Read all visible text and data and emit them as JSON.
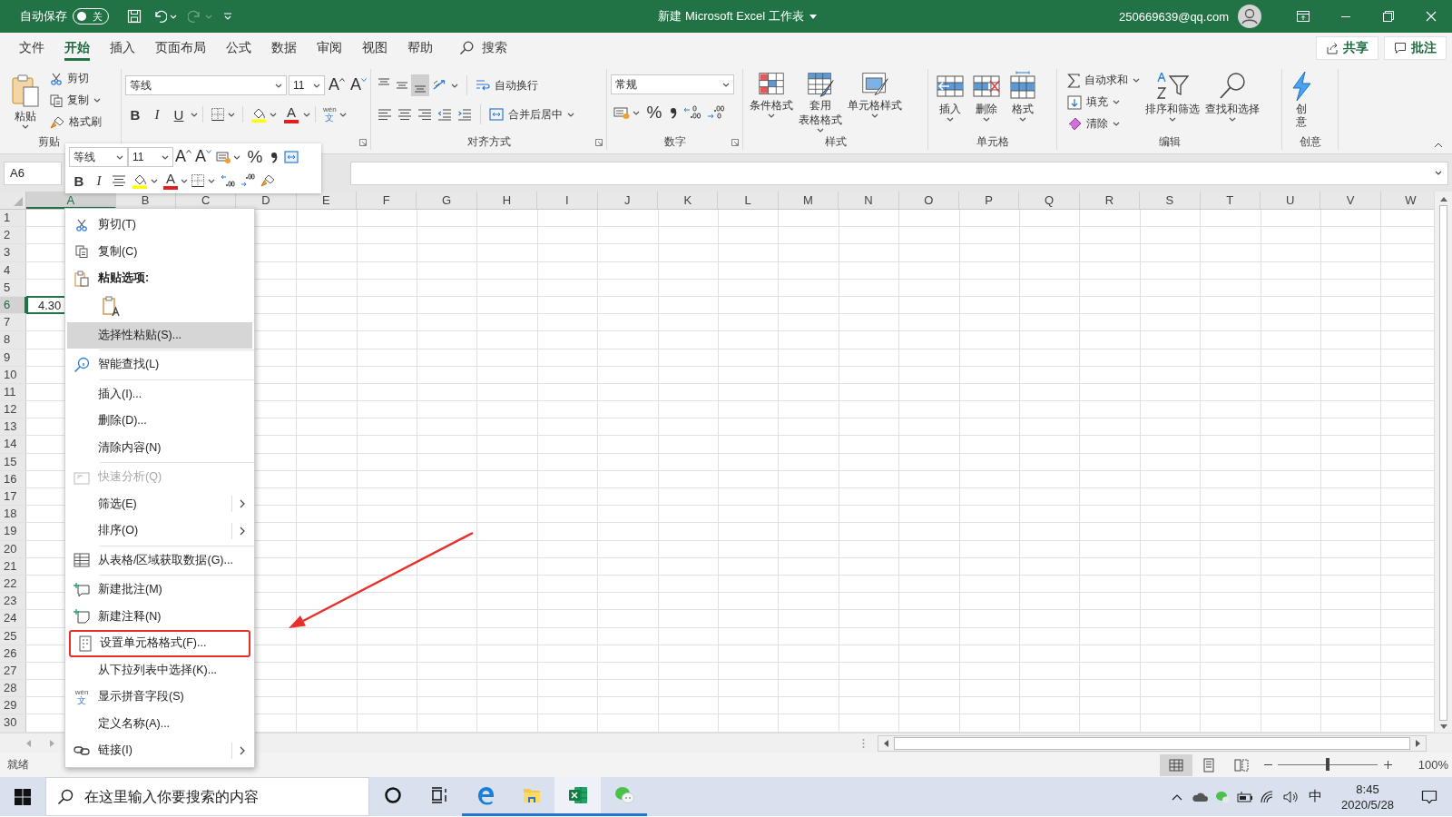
{
  "title_bar": {
    "autosave_label": "自动保存",
    "autosave_on": false,
    "autosave_state": "关",
    "redo_disabled": true,
    "title": "新建 Microsoft Excel 工作表",
    "account": "250669639@qq.com"
  },
  "menu_tabs": [
    {
      "label": "文件",
      "selected": false
    },
    {
      "label": "开始",
      "selected": true
    },
    {
      "label": "插入",
      "selected": false
    },
    {
      "label": "页面布局",
      "selected": false
    },
    {
      "label": "公式",
      "selected": false
    },
    {
      "label": "数据",
      "selected": false
    },
    {
      "label": "审阅",
      "selected": false
    },
    {
      "label": "视图",
      "selected": false
    },
    {
      "label": "帮助",
      "selected": false
    }
  ],
  "search_label": "搜索",
  "share_button": "共享",
  "comments_button": "批注",
  "ribbon": {
    "clipboard": {
      "paste": "粘贴",
      "cut": "剪切",
      "copy": "复制",
      "format_painter": "格式刷",
      "label": "剪贴"
    },
    "font": {
      "font_name": "等线",
      "font_size": "11",
      "grow": "A",
      "shrink": "A",
      "bold": "B",
      "italic": "I",
      "underline": "U",
      "font_color": "A",
      "phonetic_top": "wén",
      "phonetic_bottom": "文"
    },
    "alignment": {
      "vertical_align": [
        {
          "selected": false
        },
        {
          "selected": false
        },
        {
          "selected": true
        }
      ],
      "wrap_text": "自动换行",
      "merge_center": "合并后居中",
      "label": "对齐方式"
    },
    "number": {
      "format": "常规",
      "percent": "%",
      "label": "数字"
    },
    "styles": {
      "buttons": [
        {
          "lines": [
            "条件格式"
          ]
        },
        {
          "lines": [
            "套用",
            "表格格式"
          ]
        },
        {
          "lines": [
            "单元格样式"
          ]
        }
      ],
      "label": "样式"
    },
    "cells": {
      "buttons": [
        "插入",
        "删除",
        "格式"
      ],
      "label": "单元格"
    },
    "editing": {
      "autosum": "自动求和",
      "fill": "填充",
      "clear": "清除",
      "sort_filter": "排序和筛选",
      "find_select": "查找和选择",
      "label": "编辑"
    },
    "ideas": {
      "button": "创意",
      "label": "创意"
    }
  },
  "mini_toolbar": {
    "font_name": "等线",
    "font_size": "11",
    "grow": "A",
    "shrink": "A",
    "percent": "%",
    "bold": "B",
    "italic": "I",
    "font_color": "A"
  },
  "name_box": "A6",
  "columns": [
    {
      "label": "A",
      "selected": true
    },
    {
      "label": "B",
      "selected": false
    },
    {
      "label": "C",
      "selected": false
    },
    {
      "label": "D",
      "selected": false
    },
    {
      "label": "E",
      "selected": false
    },
    {
      "label": "F",
      "selected": false
    },
    {
      "label": "G",
      "selected": false
    },
    {
      "label": "H",
      "selected": false
    },
    {
      "label": "I",
      "selected": false
    },
    {
      "label": "J",
      "selected": false
    },
    {
      "label": "K",
      "selected": false
    },
    {
      "label": "L",
      "selected": false
    },
    {
      "label": "M",
      "selected": false
    },
    {
      "label": "N",
      "selected": false
    },
    {
      "label": "O",
      "selected": false
    },
    {
      "label": "P",
      "selected": false
    },
    {
      "label": "Q",
      "selected": false
    },
    {
      "label": "R",
      "selected": false
    },
    {
      "label": "S",
      "selected": false
    },
    {
      "label": "T",
      "selected": false
    },
    {
      "label": "U",
      "selected": false
    },
    {
      "label": "V",
      "selected": false
    },
    {
      "label": "W",
      "selected": false
    }
  ],
  "rows": [
    {
      "label": "1",
      "selected": false
    },
    {
      "label": "2",
      "selected": false
    },
    {
      "label": "3",
      "selected": false
    },
    {
      "label": "4",
      "selected": false
    },
    {
      "label": "5",
      "selected": false
    },
    {
      "label": "6",
      "selected": true,
      "cells": [
        "4.30"
      ]
    },
    {
      "label": "7",
      "selected": false
    },
    {
      "label": "8",
      "selected": false
    },
    {
      "label": "9",
      "selected": false
    },
    {
      "label": "10",
      "selected": false
    },
    {
      "label": "11",
      "selected": false
    },
    {
      "label": "12",
      "selected": false
    },
    {
      "label": "13",
      "selected": false
    },
    {
      "label": "14",
      "selected": false
    },
    {
      "label": "15",
      "selected": false
    },
    {
      "label": "16",
      "selected": false
    },
    {
      "label": "17",
      "selected": false
    },
    {
      "label": "18",
      "selected": false
    },
    {
      "label": "19",
      "selected": false
    },
    {
      "label": "20",
      "selected": false
    },
    {
      "label": "21",
      "selected": false
    },
    {
      "label": "22",
      "selected": false
    },
    {
      "label": "23",
      "selected": false
    },
    {
      "label": "24",
      "selected": false
    },
    {
      "label": "25",
      "selected": false
    },
    {
      "label": "26",
      "selected": false
    },
    {
      "label": "27",
      "selected": false
    },
    {
      "label": "28",
      "selected": false
    },
    {
      "label": "29",
      "selected": false
    },
    {
      "label": "30",
      "selected": false
    }
  ],
  "context_menu": {
    "callout_arrow": true,
    "items": [
      {
        "kind": "item",
        "label": "剪切(T)",
        "selected": false,
        "disabled": false,
        "submenu": false,
        "outlined": false
      },
      {
        "kind": "item",
        "label": "复制(C)",
        "selected": false,
        "disabled": false,
        "submenu": false,
        "outlined": false
      },
      {
        "kind": "header",
        "label": "粘贴选项:"
      },
      {
        "kind": "paste_options"
      },
      {
        "kind": "item",
        "label": "选择性粘贴(S)...",
        "selected": true,
        "disabled": false,
        "submenu": false,
        "outlined": false
      },
      {
        "kind": "separator"
      },
      {
        "kind": "item",
        "label": "智能查找(L)",
        "selected": false,
        "disabled": false,
        "submenu": false,
        "outlined": false
      },
      {
        "kind": "separator"
      },
      {
        "kind": "item",
        "label": "插入(I)...",
        "selected": false,
        "disabled": false,
        "submenu": false,
        "outlined": false
      },
      {
        "kind": "item",
        "label": "删除(D)...",
        "selected": false,
        "disabled": false,
        "submenu": false,
        "outlined": false
      },
      {
        "kind": "item",
        "label": "清除内容(N)",
        "selected": false,
        "disabled": false,
        "submenu": false,
        "outlined": false
      },
      {
        "kind": "separator"
      },
      {
        "kind": "item",
        "label": "快速分析(Q)",
        "selected": false,
        "disabled": true,
        "submenu": false,
        "outlined": false
      },
      {
        "kind": "item",
        "label": "筛选(E)",
        "selected": false,
        "disabled": false,
        "submenu": true,
        "outlined": false
      },
      {
        "kind": "item",
        "label": "排序(O)",
        "selected": false,
        "disabled": false,
        "submenu": true,
        "outlined": false
      },
      {
        "kind": "separator"
      },
      {
        "kind": "item",
        "label": "从表格/区域获取数据(G)...",
        "selected": false,
        "disabled": false,
        "submenu": false,
        "outlined": false
      },
      {
        "kind": "separator"
      },
      {
        "kind": "item",
        "label": "新建批注(M)",
        "selected": false,
        "disabled": false,
        "submenu": false,
        "outlined": false
      },
      {
        "kind": "item",
        "label": "新建注释(N)",
        "selected": false,
        "disabled": false,
        "submenu": false,
        "outlined": false
      },
      {
        "kind": "item",
        "label": "设置单元格格式(F)...",
        "selected": false,
        "disabled": false,
        "submenu": false,
        "outlined": true
      },
      {
        "kind": "item",
        "label": "从下拉列表中选择(K)...",
        "selected": false,
        "disabled": false,
        "submenu": false,
        "outlined": false
      },
      {
        "kind": "item",
        "label": "显示拼音字段(S)",
        "icon_top": "wén",
        "icon_bottom": "文",
        "selected": false,
        "disabled": false,
        "submenu": false,
        "outlined": false
      },
      {
        "kind": "item",
        "label": "定义名称(A)...",
        "selected": false,
        "disabled": false,
        "submenu": false,
        "outlined": false
      },
      {
        "kind": "item",
        "label": "链接(I)",
        "selected": false,
        "disabled": false,
        "submenu": true,
        "outlined": false
      }
    ]
  },
  "status_bar": {
    "text": "就绪",
    "views": [
      {
        "kind": "normal",
        "selected": true
      },
      {
        "kind": "page_layout",
        "selected": false
      },
      {
        "kind": "page_break",
        "selected": false
      }
    ],
    "zoom_slider": {
      "level": 0.5
    },
    "zoom": "100%"
  },
  "taskbar": {
    "search_placeholder": "在这里输入你要搜索的内容",
    "apps": [
      {
        "kind": "cortana",
        "running": false,
        "selected": false
      },
      {
        "kind": "task_view",
        "running": false,
        "selected": false
      },
      {
        "kind": "edge",
        "running": true,
        "selected": false
      },
      {
        "kind": "explorer",
        "running": true,
        "selected": false
      },
      {
        "kind": "excel",
        "running": true,
        "selected": true
      },
      {
        "kind": "wechat",
        "running": true,
        "selected": false
      }
    ],
    "ime": "中",
    "time": "8:45",
    "date": "2020/5/28"
  }
}
